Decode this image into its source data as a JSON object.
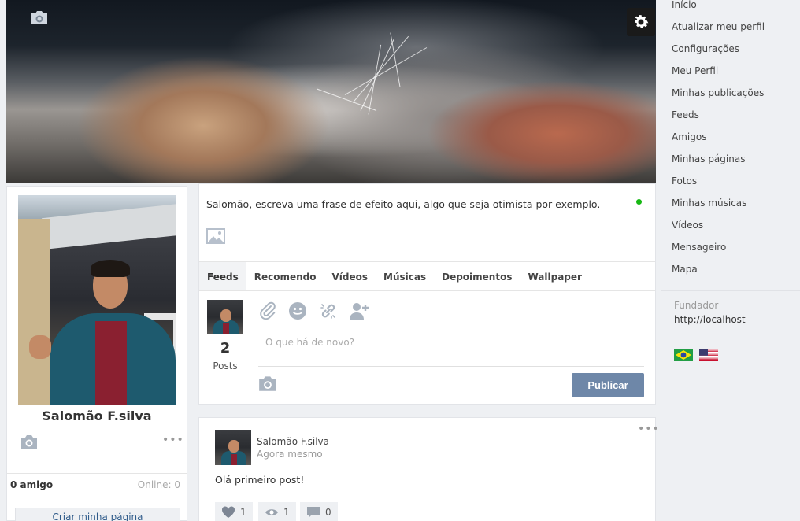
{
  "profile": {
    "name": "Salomão F.silva",
    "friends_label": "0 amigo",
    "online_label": "Online: 0",
    "create_page_label": "Criar minha página"
  },
  "status": {
    "prompt": "Salomão, escreva uma frase de efeito aqui, algo que seja otimista por exemplo."
  },
  "tabs": [
    {
      "label": "Feeds",
      "active": true
    },
    {
      "label": "Recomendo"
    },
    {
      "label": "Vídeos"
    },
    {
      "label": "Músicas"
    },
    {
      "label": "Depoimentos"
    },
    {
      "label": "Wallpaper"
    }
  ],
  "composer": {
    "post_count": "2",
    "post_count_label": "Posts",
    "placeholder": "O que há de novo?",
    "publish_label": "Publicar",
    "tools": [
      "paperclip-icon",
      "smiley-icon",
      "link-icon",
      "add-user-icon"
    ]
  },
  "post": {
    "author": "Salomão F.silva",
    "time": "Agora mesmo",
    "body": "Olá primeiro post!",
    "likes": "1",
    "views": "1",
    "comments": "0"
  },
  "menu": [
    "Início",
    "Atualizar meu perfil",
    "Configurações",
    "Meu Perfil",
    "Minhas publicações",
    "Feeds",
    "Amigos",
    "Minhas páginas",
    "Fotos",
    "Minhas músicas",
    "Vídeos",
    "Mensageiro",
    "Mapa"
  ],
  "founder": {
    "label": "Fundador",
    "link": "http://localhost"
  },
  "colors": {
    "accent": "#6e87a8",
    "online_dot": "#17b814",
    "link": "#2f5b8a"
  }
}
